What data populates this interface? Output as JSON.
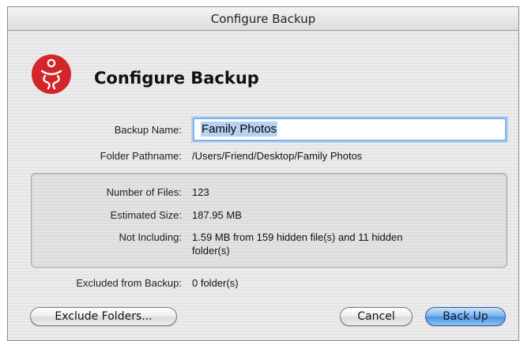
{
  "window": {
    "title": "Configure Backup"
  },
  "header": {
    "title": "Configure Backup",
    "logo_icon": "backup-app-logo-icon",
    "logo_color": "#d2262b"
  },
  "form": {
    "backup_name_label": "Backup Name:",
    "backup_name_value": "Family Photos",
    "folder_path_label": "Folder Pathname:",
    "folder_path_value": "/Users/Friend/Desktop/Family Photos"
  },
  "summary": {
    "files_label": "Number of Files:",
    "files_value": "123",
    "size_label": "Estimated Size:",
    "size_value": "187.95 MB",
    "not_including_label": "Not Including:",
    "not_including_line1": "1.59 MB from 159 hidden file(s) and 11 hidden",
    "not_including_line2": "folder(s)"
  },
  "excluded": {
    "label": "Excluded from Backup:",
    "value": "0 folder(s)"
  },
  "buttons": {
    "exclude": "Exclude Folders...",
    "cancel": "Cancel",
    "backup": "Back Up"
  },
  "colors": {
    "accent": "#4f93de",
    "selection": "#b5d2f3"
  }
}
